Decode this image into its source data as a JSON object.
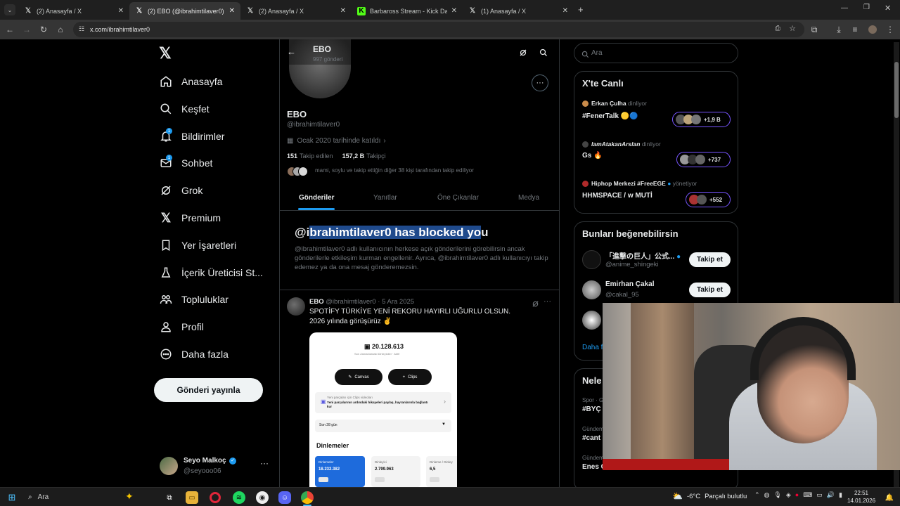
{
  "browser": {
    "tabs": [
      {
        "title": "(2) Anasayfa / X",
        "icon": "x-icon"
      },
      {
        "title": "(2) EBO (@ibrahimtilaver0) / X",
        "icon": "x-icon",
        "active": true
      },
      {
        "title": "(2) Anasayfa / X",
        "icon": "x-icon"
      },
      {
        "title": "Barbaross Stream - Kick Dashboard",
        "icon": "kick-icon"
      },
      {
        "title": "(1) Anasayfa / X",
        "icon": "x-icon"
      }
    ],
    "url": "x.com/ibrahimtilaver0"
  },
  "sidebar": {
    "items": [
      {
        "label": "Anasayfa",
        "icon": "home-icon"
      },
      {
        "label": "Keşfet",
        "icon": "search-icon"
      },
      {
        "label": "Bildirimler",
        "icon": "bell-icon",
        "badge": "1"
      },
      {
        "label": "Sohbet",
        "icon": "mail-icon",
        "badge": "1"
      },
      {
        "label": "Grok",
        "icon": "grok-icon"
      },
      {
        "label": "Premium",
        "icon": "x-icon"
      },
      {
        "label": "Yer İşaretleri",
        "icon": "bookmark-icon"
      },
      {
        "label": "İçerik Üreticisi St...",
        "icon": "flask-icon"
      },
      {
        "label": "Topluluklar",
        "icon": "people-icon"
      },
      {
        "label": "Profil",
        "icon": "person-icon"
      },
      {
        "label": "Daha fazla",
        "icon": "more-circle-icon"
      }
    ],
    "post_button": "Gönderi yayınla",
    "account": {
      "name": "Seyo Malkoç",
      "handle": "@seyooo06"
    }
  },
  "profile": {
    "header_name": "EBO",
    "header_posts": "997 gönderi",
    "name": "EBO",
    "handle": "@ibrahimtilaver0",
    "joined": "Ocak 2020 tarihinde katıldı",
    "following_count": "151",
    "following_label": "Takip edilen",
    "followers_count": "157,2 B",
    "followers_label": "Takipçi",
    "followed_by": "mami, soylu ve takip ettiğin diğer 38 kişi tarafından takip ediliyor",
    "tabs": [
      "Gönderiler",
      "Yanıtlar",
      "Öne Çıkanlar",
      "Medya"
    ],
    "blocked_pre": "@i",
    "blocked_sel": "brahimtilaver0 has blocked yo",
    "blocked_post": "u",
    "blocked_text": "@ibrahimtilaver0 adlı kullanıcının herkese açık gönderilerini görebilirsin ancak gönderilerle etkileşim kurman engellenir. Ayrıca, @ibrahimtilaver0 adlı kullanıcıyı takip edemez ya da ona mesaj gönderemezsin."
  },
  "post": {
    "name": "EBO",
    "handle": "@ibrahimtilaver0",
    "date": "· 5 Ara 2025",
    "line1": "SPOTİFY TÜRKİYE YENİ REKORU HAYIRLI UĞURLU OLSUN.",
    "line2": "2026 yılında görüşürüz ✌️",
    "img": {
      "count": "20.128.613",
      "sub": "Son Zamanlardaki Dinleyiciler · Aktif",
      "btn1": "Canvas",
      "btn2": "Clips",
      "promo1": "Yeni parçaları için Clips videoları",
      "promo2": "Yeni parçalarının ardındaki hikayeleri paylaş, hayranlarınla bağlantı kur",
      "range": "Son 28 gün",
      "section": "Dinlemeler",
      "m1_label": "Dinlemeler",
      "m1_value": "18.232.382",
      "m2_label": "Dinleyici",
      "m2_value": "2.799.963",
      "m3_label": "Dinleme / Dinley",
      "m3_value": "6,5"
    }
  },
  "right": {
    "search_placeholder": "Ara",
    "live_title": "X'te Canlı",
    "live": [
      {
        "host": "Erkan Çulha",
        "status": "dinliyor",
        "title": "#FenerTalk 🟡🔵",
        "count": "+1,9 B"
      },
      {
        "host": "IamAtakanArslan",
        "status": "dinliyor",
        "title": "Gs 🔥",
        "count": "+737"
      },
      {
        "host": "Hiphop Merkezi #FreeEGE",
        "status": "yönetiyor",
        "title": "HHMSPACE / w MUTİ",
        "count": "+552"
      }
    ],
    "suggest_title": "Bunları beğenebilirsin",
    "suggest": [
      {
        "name": "「進撃の巨人」公式...",
        "handle": "@anime_shingeki",
        "btn": "Takip et"
      },
      {
        "name": "Emirhan Çakal",
        "handle": "@cakal_95",
        "btn": "Takip et"
      }
    ],
    "more": "Daha f",
    "trend_title": "Nele",
    "trends": [
      {
        "cat": "Spor · G",
        "name": "#BYÇ"
      },
      {
        "cat": "Gündem",
        "name": "#cant"
      },
      {
        "cat": "Gündem",
        "name": "Enes Ç"
      }
    ]
  },
  "taskbar": {
    "search": "Ara",
    "weather": "-6°C",
    "weather_desc": "Parçalı bulutlu",
    "time": "22:51",
    "date": "14.01.2026"
  },
  "colors": {
    "accent": "#1d9bf0",
    "bg": "#000000",
    "border": "#2f3336",
    "muted": "#71767b",
    "selection": "#1f4a8c"
  }
}
